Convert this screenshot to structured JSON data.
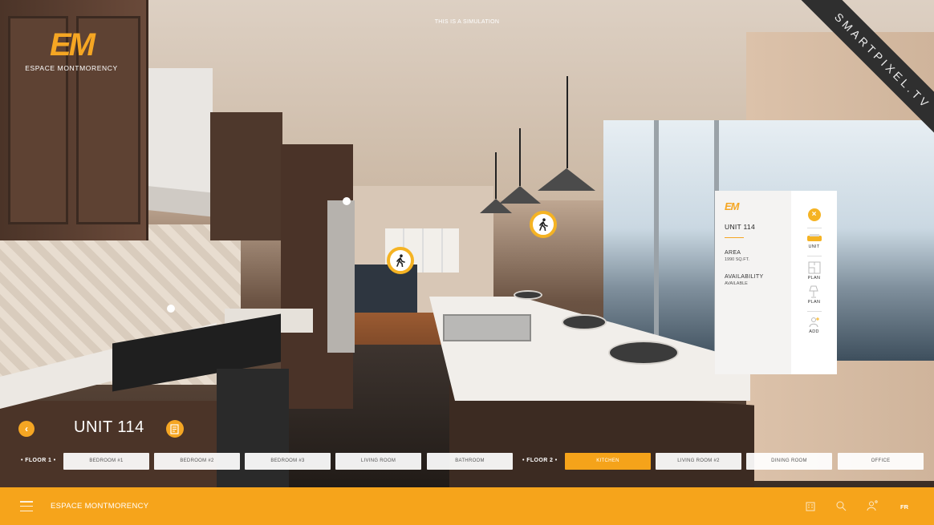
{
  "header": {
    "simulation_notice": "THIS IS A SIMULATION",
    "logo_mark": "EM",
    "logo_name": "ESPACE MONTMORENCY"
  },
  "watermark": "SMARTPIXEL.TV",
  "info_panel": {
    "logo_mark": "EM",
    "unit": "UNIT 114",
    "area_label": "AREA",
    "area_value": "1990 SQ.FT.",
    "availability_label": "AVAILABILITY",
    "availability_value": "AVAILABLE",
    "actions": [
      {
        "label": "UNIT",
        "icon": "unit-icon"
      },
      {
        "label": "PLAN",
        "icon": "floorplan-icon"
      },
      {
        "label": "PLAN",
        "icon": "lamp-icon"
      },
      {
        "label": "ADD",
        "icon": "add-user-icon"
      }
    ]
  },
  "unit_nav": {
    "title": "UNIT 114",
    "floors": [
      {
        "label": "FLOOR 1",
        "rooms": [
          "BEDROOM #1",
          "BEDROOM #2",
          "BEDROOM #3",
          "LIVING ROOM",
          "BATHROOM"
        ]
      },
      {
        "label": "FLOOR 2",
        "rooms": [
          "KITCHEN",
          "LIVING ROOM #2",
          "DINING ROOM",
          "OFFICE"
        ]
      }
    ],
    "active_room": "KITCHEN"
  },
  "bottom_bar": {
    "title": "ESPACE MONTMORENCY",
    "language": "FR",
    "icons": [
      "building-icon",
      "search-icon",
      "user-icon"
    ]
  },
  "colors": {
    "accent": "#f6a41b",
    "panel_bg": "#ffffff"
  }
}
